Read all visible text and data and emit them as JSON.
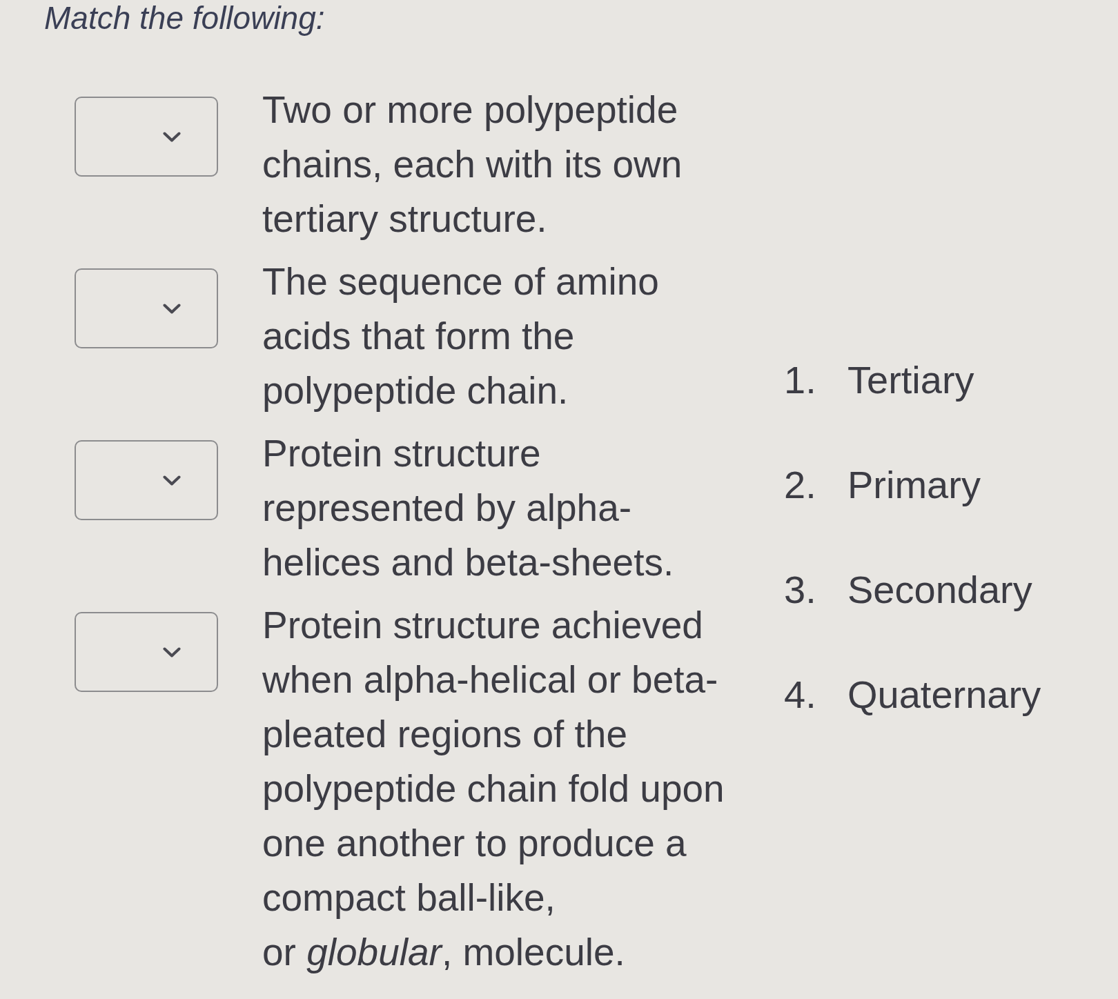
{
  "title": "Match the following:",
  "prompts": [
    {
      "text": "Two or more polypeptide chains, each with its own tertiary structure."
    },
    {
      "text": "The sequence of amino acids that form the polypeptide chain."
    },
    {
      "text": "Protein structure represented by alpha-helices and beta-sheets."
    },
    {
      "text": "Protein structure achieved when alpha-helical or beta-pleated regions of the polypeptide chain fold upon one another to produce a compact ball-like,\nor *globular*, molecule."
    }
  ],
  "answers": [
    {
      "number": "1.",
      "label": "Tertiary"
    },
    {
      "number": "2.",
      "label": "Primary"
    },
    {
      "number": "3.",
      "label": "Secondary"
    },
    {
      "number": "4.",
      "label": "Quaternary"
    }
  ]
}
